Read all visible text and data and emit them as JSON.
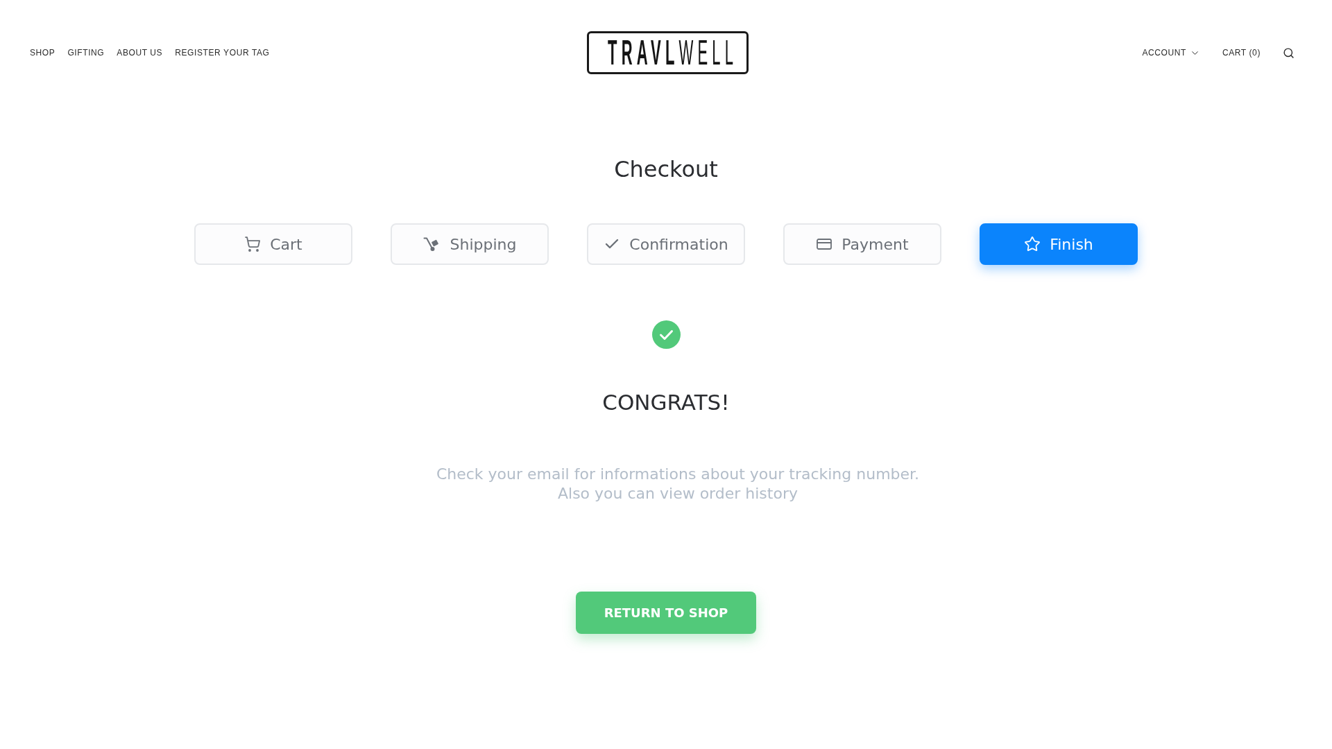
{
  "header": {
    "nav_left": [
      "SHOP",
      "GIFTING",
      "ABOUT US",
      "REGISTER YOUR TAG"
    ],
    "logo": "**TRAVL**WELL",
    "account": "ACCOUNT",
    "cart": "CART (0)"
  },
  "checkout": {
    "title": "Checkout",
    "steps": [
      {
        "label": "Cart",
        "selected": false
      },
      {
        "label": "Shipping",
        "selected": false
      },
      {
        "label": "Confirmation",
        "selected": false
      },
      {
        "label": "Payment",
        "selected": false
      },
      {
        "label": "Finish",
        "selected": true
      }
    ],
    "result": {
      "title": "CONGRATS!",
      "message": "Check your email for informations about your tracking number.\nAlso you can view order history",
      "button": "RETURN TO SHOP"
    }
  }
}
